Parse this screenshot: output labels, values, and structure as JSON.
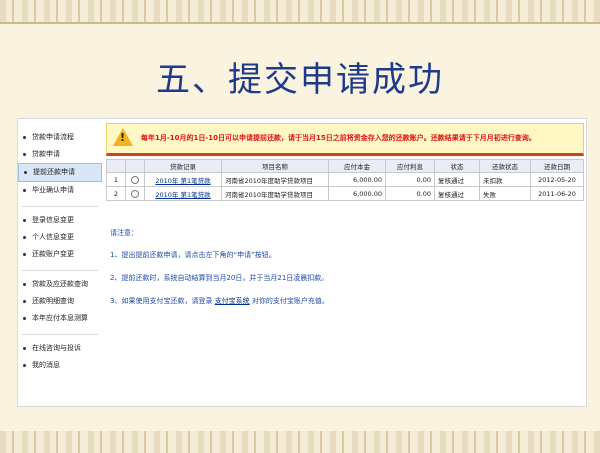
{
  "slide_title": "五、提交申请成功",
  "sidebar": {
    "groups": [
      [
        {
          "label": "贷款申请流程",
          "active": false
        },
        {
          "label": "贷款申请",
          "active": false
        },
        {
          "label": "提前还款申请",
          "active": true
        },
        {
          "label": "毕业确认申请",
          "active": false
        }
      ],
      [
        {
          "label": "登录信息变更",
          "active": false
        },
        {
          "label": "个人信息变更",
          "active": false
        },
        {
          "label": "还款账户变更",
          "active": false
        }
      ],
      [
        {
          "label": "贷款及应还款查询",
          "active": false
        },
        {
          "label": "还款明细查询",
          "active": false
        },
        {
          "label": "本年应付本息测算",
          "active": false
        }
      ],
      [
        {
          "label": "在线咨询与投诉",
          "active": false
        },
        {
          "label": "我的消息",
          "active": false
        }
      ]
    ]
  },
  "warning": {
    "icon": "warning-icon",
    "text": "每年1月-10月的1日-10日可以申请提前还款，请于当月15日之前将资金存入您的还款账户。还款结果请于下月月初进行查询。"
  },
  "table": {
    "headers": [
      "",
      "",
      "贷款记录",
      "项目名称",
      "应付本金",
      "应付利息",
      "状态",
      "还款状态",
      "还款日期"
    ],
    "rows": [
      {
        "no": "1",
        "record": "2010年 第1笔贷款",
        "project": "河南省2010年度助学贷款项目",
        "principal": "6,000.00",
        "interest": "0.00",
        "status": "复核通过",
        "repay_status": "未扣款",
        "date": "2012-05-20"
      },
      {
        "no": "2",
        "record": "2010年 第1笔贷款",
        "project": "河南省2010年度助学贷款项目",
        "principal": "6,000.00",
        "interest": "0.00",
        "status": "复核通过",
        "repay_status": "失败",
        "date": "2011-06-20"
      }
    ]
  },
  "notes": {
    "heading": "请注意：",
    "note1": "1、提出提前还款申请，请点击左下角的“申请”按钮。",
    "note2": "2、提前还款时，系统自动结算到当月20日，并于当月21日凌晨扣款。",
    "note3_before": "3、如果使用支付宝还款，请登录 ",
    "note3_link": "支付宝系统",
    "note3_after": " 对你的支付宝账户充值。"
  },
  "colors": {
    "title": "#1d3b8a",
    "warning_text": "#dd1111",
    "notes": "#1f4aa8"
  }
}
